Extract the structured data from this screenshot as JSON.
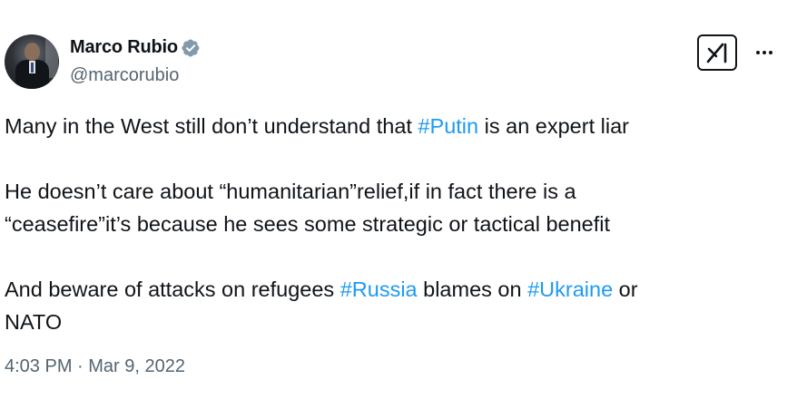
{
  "author": {
    "name": "Marco Rubio",
    "handle": "@marcorubio",
    "verified_badge": "verified-badge-icon",
    "verified_color": "#829aab"
  },
  "header_actions": {
    "grok_icon": "grok-x-icon",
    "more_icon": "more-options-icon"
  },
  "tweet": {
    "line1_before": "Many in the West still don’t understand that ",
    "line1_tag": "#Putin",
    "line1_after": " is an expert liar",
    "para2_line1": "He doesn’t care about “humanitarian”relief,if in fact there is a",
    "para2_line2": "“ceasefire”it’s because he sees some strategic or tactical benefit",
    "para3_before": "And beware of attacks on refugees ",
    "para3_tag1": "#Russia",
    "para3_mid": " blames on ",
    "para3_tag2": "#Ukraine",
    "para3_after": " or",
    "para3_line2": "NATO"
  },
  "colors": {
    "hashtag": "#1d9bf0",
    "secondary_text": "#536471",
    "primary_text": "#0f1419"
  },
  "timestamp": "4:03 PM · Mar 9, 2022"
}
